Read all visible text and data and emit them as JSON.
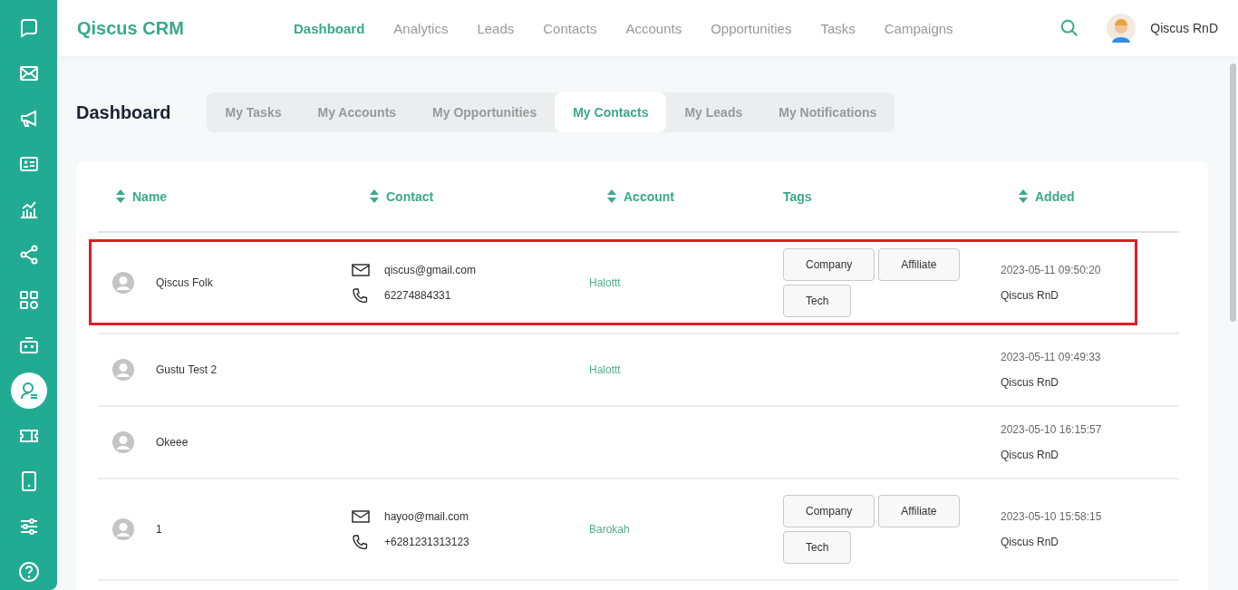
{
  "sidebar": {
    "items": [
      {
        "selected": false
      },
      {
        "selected": false
      },
      {
        "selected": false
      },
      {
        "selected": false
      },
      {
        "selected": false
      },
      {
        "selected": false
      },
      {
        "selected": false
      },
      {
        "selected": false
      },
      {
        "selected": true
      },
      {
        "selected": false
      },
      {
        "selected": false
      },
      {
        "selected": false
      },
      {
        "selected": false
      }
    ]
  },
  "header": {
    "brand": "Qiscus CRM",
    "nav": [
      {
        "label": "Dashboard",
        "selected": true
      },
      {
        "label": "Analytics",
        "selected": false
      },
      {
        "label": "Leads",
        "selected": false
      },
      {
        "label": "Contacts",
        "selected": false
      },
      {
        "label": "Accounts",
        "selected": false
      },
      {
        "label": "Opportunities",
        "selected": false
      },
      {
        "label": "Tasks",
        "selected": false
      },
      {
        "label": "Campaigns",
        "selected": false
      }
    ],
    "user": "Qiscus RnD"
  },
  "page_title": "Dashboard",
  "tabs": [
    {
      "label": "My Tasks",
      "selected": false
    },
    {
      "label": "My Accounts",
      "selected": false
    },
    {
      "label": "My Opportunities",
      "selected": false
    },
    {
      "label": "My Contacts",
      "selected": true
    },
    {
      "label": "My Leads",
      "selected": false
    },
    {
      "label": "My Notifications",
      "selected": false
    }
  ],
  "table": {
    "columns": [
      {
        "label": "Name",
        "sortable": true
      },
      {
        "label": "Contact",
        "sortable": true
      },
      {
        "label": "Account",
        "sortable": true
      },
      {
        "label": "Tags",
        "sortable": false
      },
      {
        "label": "Added",
        "sortable": true
      }
    ],
    "rows": [
      {
        "name": "Qiscus Folk",
        "email": "qiscus@gmail.com",
        "phone": "62274884331",
        "account": "Halottt",
        "tags": [
          "Company",
          "Affiliate",
          "Tech"
        ],
        "added": "2023-05-11 09:50:20",
        "added_by": "Qiscus RnD",
        "highlighted": true
      },
      {
        "name": "Gustu Test 2",
        "account": "Halottt",
        "tags": [],
        "added": "2023-05-11 09:49:33",
        "added_by": "Qiscus RnD",
        "highlighted": false
      },
      {
        "name": "Okeee",
        "tags": [],
        "added": "2023-05-10 16:15:57",
        "added_by": "Qiscus RnD",
        "highlighted": false
      },
      {
        "name": "1",
        "email": "hayoo@mail.com",
        "phone": "+6281231313123",
        "account": "Barokah",
        "tags": [
          "Company",
          "Affiliate",
          "Tech"
        ],
        "added": "2023-05-10 15:58:15",
        "added_by": "Qiscus RnD",
        "highlighted": false
      }
    ]
  }
}
